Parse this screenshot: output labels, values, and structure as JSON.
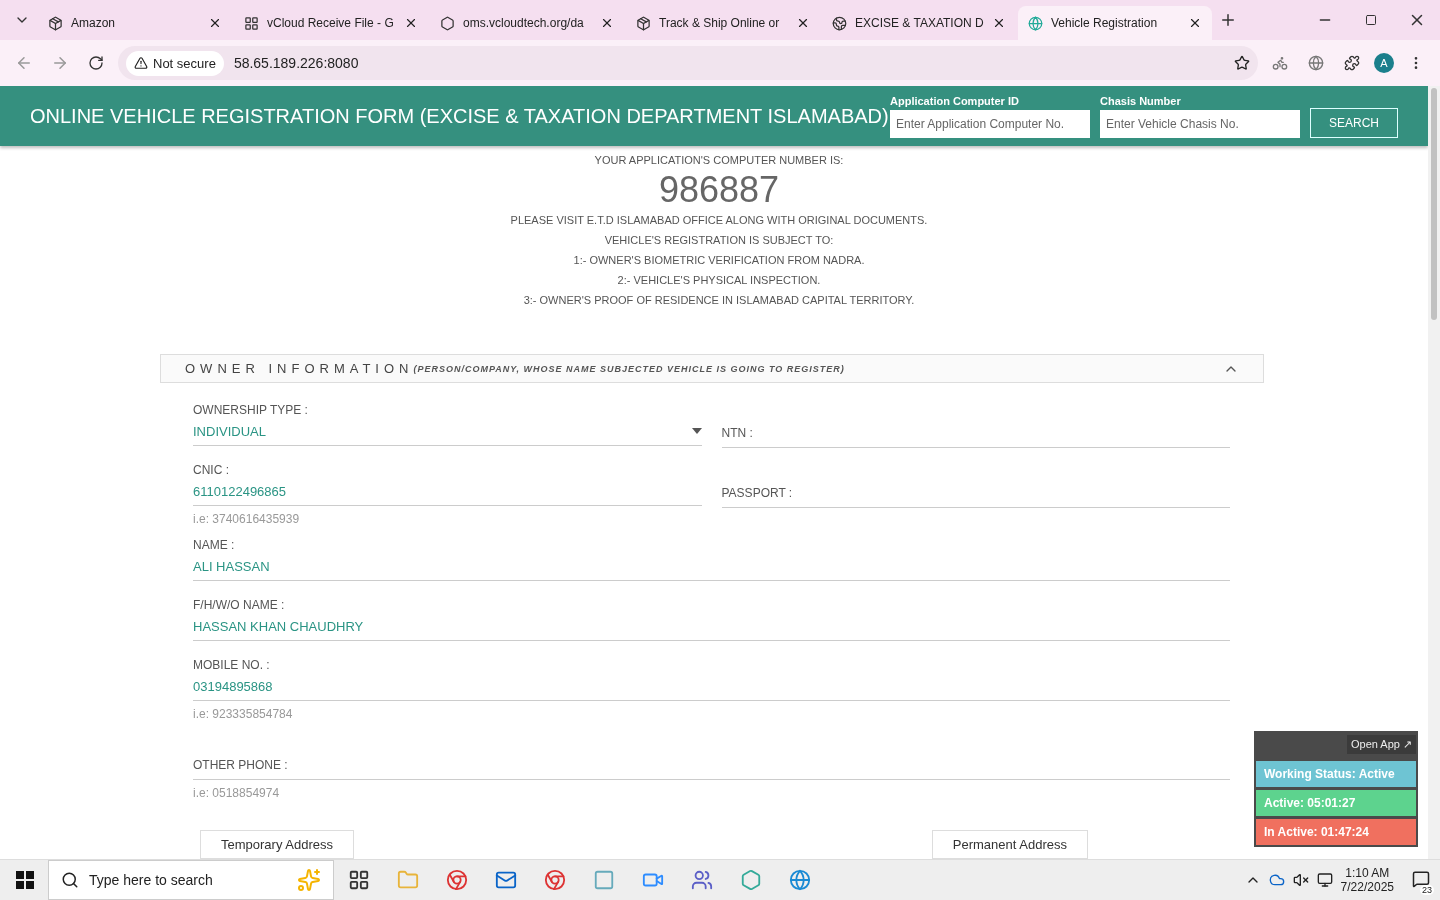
{
  "browser": {
    "tabs": [
      {
        "title": "Amazon",
        "selected": false
      },
      {
        "title": "vCloud Receive File - G",
        "selected": false
      },
      {
        "title": "oms.vcloudtech.org/da",
        "selected": false
      },
      {
        "title": "Track & Ship Online or",
        "selected": false
      },
      {
        "title": "EXCISE & TAXATION D",
        "selected": false
      },
      {
        "title": "Vehicle Registration",
        "selected": true
      }
    ],
    "security": "Not secure",
    "url": "58.65.189.226:8080",
    "profile": "A"
  },
  "header": {
    "title": "ONLINE VEHICLE REGISTRATION FORM (EXCISE & TAXATION DEPARTMENT ISLAMABAD)",
    "search_fields": [
      {
        "label": "Application Computer ID",
        "placeholder": "Enter Application Computer No."
      },
      {
        "label": "Chasis Number",
        "placeholder": "Enter Vehicle Chasis No."
      }
    ],
    "search_button": "SEARCH"
  },
  "notice": {
    "intro": "YOUR APPLICATION'S COMPUTER NUMBER IS:",
    "number": "986887",
    "lines": [
      "PLEASE VISIT E.T.D ISLAMABAD OFFICE ALONG WITH ORIGINAL DOCUMENTS.",
      "VEHICLE'S REGISTRATION IS SUBJECT TO:",
      "1:- OWNER'S BIOMETRIC VERIFICATION FROM NADRA.",
      "2:- VEHICLE'S PHYSICAL INSPECTION.",
      "3:- OWNER'S PROOF OF RESIDENCE IN ISLAMABAD CAPITAL TERRITORY."
    ]
  },
  "section": {
    "title": "OWNER INFORMATION",
    "subtitle": "(PERSON/COMPANY, WHOSE NAME SUBJECTED VEHICLE IS GOING TO REGISTER)",
    "expanded": true,
    "rows": [
      [
        {
          "kind": "select",
          "label": "OWNERSHIP TYPE :",
          "value": "INDIVIDUAL"
        },
        {
          "kind": "inline",
          "label": "NTN :"
        }
      ],
      [
        {
          "kind": "text",
          "label": "CNIC :",
          "value": "6110122496865",
          "hint": "i.e: 3740616435939"
        },
        {
          "kind": "inline",
          "label": "PASSPORT :"
        }
      ],
      [
        {
          "kind": "text",
          "label": "NAME :",
          "value": "ALI HASSAN"
        }
      ],
      [
        {
          "kind": "text",
          "label": "F/H/W/O NAME :",
          "value": "HASSAN KHAN CHAUDHRY"
        }
      ],
      [
        {
          "kind": "text",
          "label": "MOBILE NO. :",
          "value": "03194895868",
          "hint": "i.e: 923335854784"
        }
      ],
      [
        {
          "kind": "inline",
          "label": "OTHER PHONE :",
          "hint": "i.e: 0518854974"
        }
      ]
    ],
    "address_tabs": [
      "Temporary Address",
      "Permanent Address"
    ]
  },
  "widget": {
    "open_app": "Open App ↗",
    "statuses": [
      {
        "text": "Working Status: Active",
        "color": "#6ec4d3"
      },
      {
        "text": "Active: 05:01:27",
        "color": "#5dd38e"
      },
      {
        "text": "In Active: 01:47:24",
        "color": "#f0705f"
      }
    ]
  },
  "taskbar": {
    "search_placeholder": "Type here to search",
    "time": "1:10 AM",
    "date": "7/22/2025",
    "notifications": "23"
  }
}
